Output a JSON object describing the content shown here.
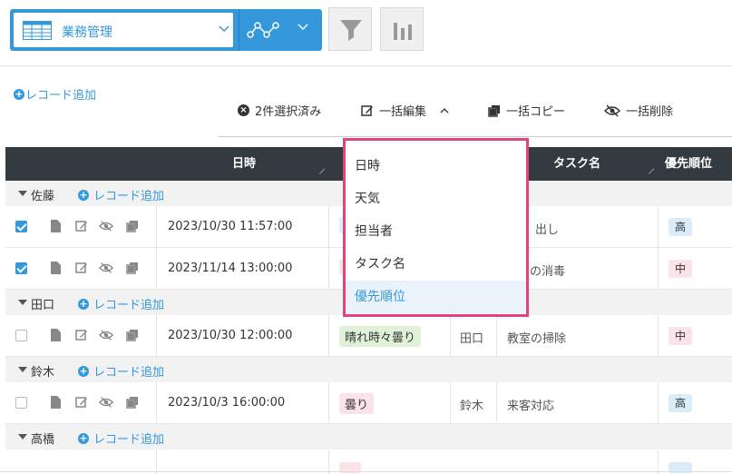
{
  "toolbar": {
    "view_name": "業務管理"
  },
  "add_record_label": "レコード追加",
  "bulk": {
    "selected": "2件選択済み",
    "edit": "一括編集",
    "copy": "一括コピー",
    "delete": "一括削除"
  },
  "table": {
    "columns": {
      "datetime": "日時",
      "task": "タスク名",
      "priority": "優先順位"
    },
    "groups": [
      {
        "name": "佐藤",
        "add_label": "レコード追加",
        "rows": [
          {
            "checked": true,
            "datetime": "2023/10/30 11:57:00",
            "weather": "",
            "who": "",
            "task": "出し",
            "priority": "高"
          },
          {
            "checked": true,
            "datetime": "2023/11/14 13:00:00",
            "weather": "",
            "who": "",
            "task": "の消毒",
            "priority": "中"
          }
        ]
      },
      {
        "name": "田口",
        "add_label": "レコード追加",
        "rows": [
          {
            "checked": false,
            "datetime": "2023/10/30 12:00:00",
            "weather": "晴れ時々曇り",
            "who": "田口",
            "task": "教室の掃除",
            "priority": "中"
          }
        ]
      },
      {
        "name": "鈴木",
        "add_label": "レコード追加",
        "rows": [
          {
            "checked": false,
            "datetime": "2023/10/3 16:00:00",
            "weather": "曇り",
            "who": "鈴木",
            "task": "来客対応",
            "priority": "高"
          }
        ]
      },
      {
        "name": "高橋",
        "add_label": "レコード追加",
        "rows": []
      }
    ]
  },
  "column_menu": {
    "items": [
      "日時",
      "天気",
      "担当者",
      "タスク名",
      "優先順位"
    ],
    "active_index": 4
  },
  "colors": {
    "accent": "#3498db",
    "header_bg": "#333a40",
    "highlight_border": "#e2437f"
  }
}
